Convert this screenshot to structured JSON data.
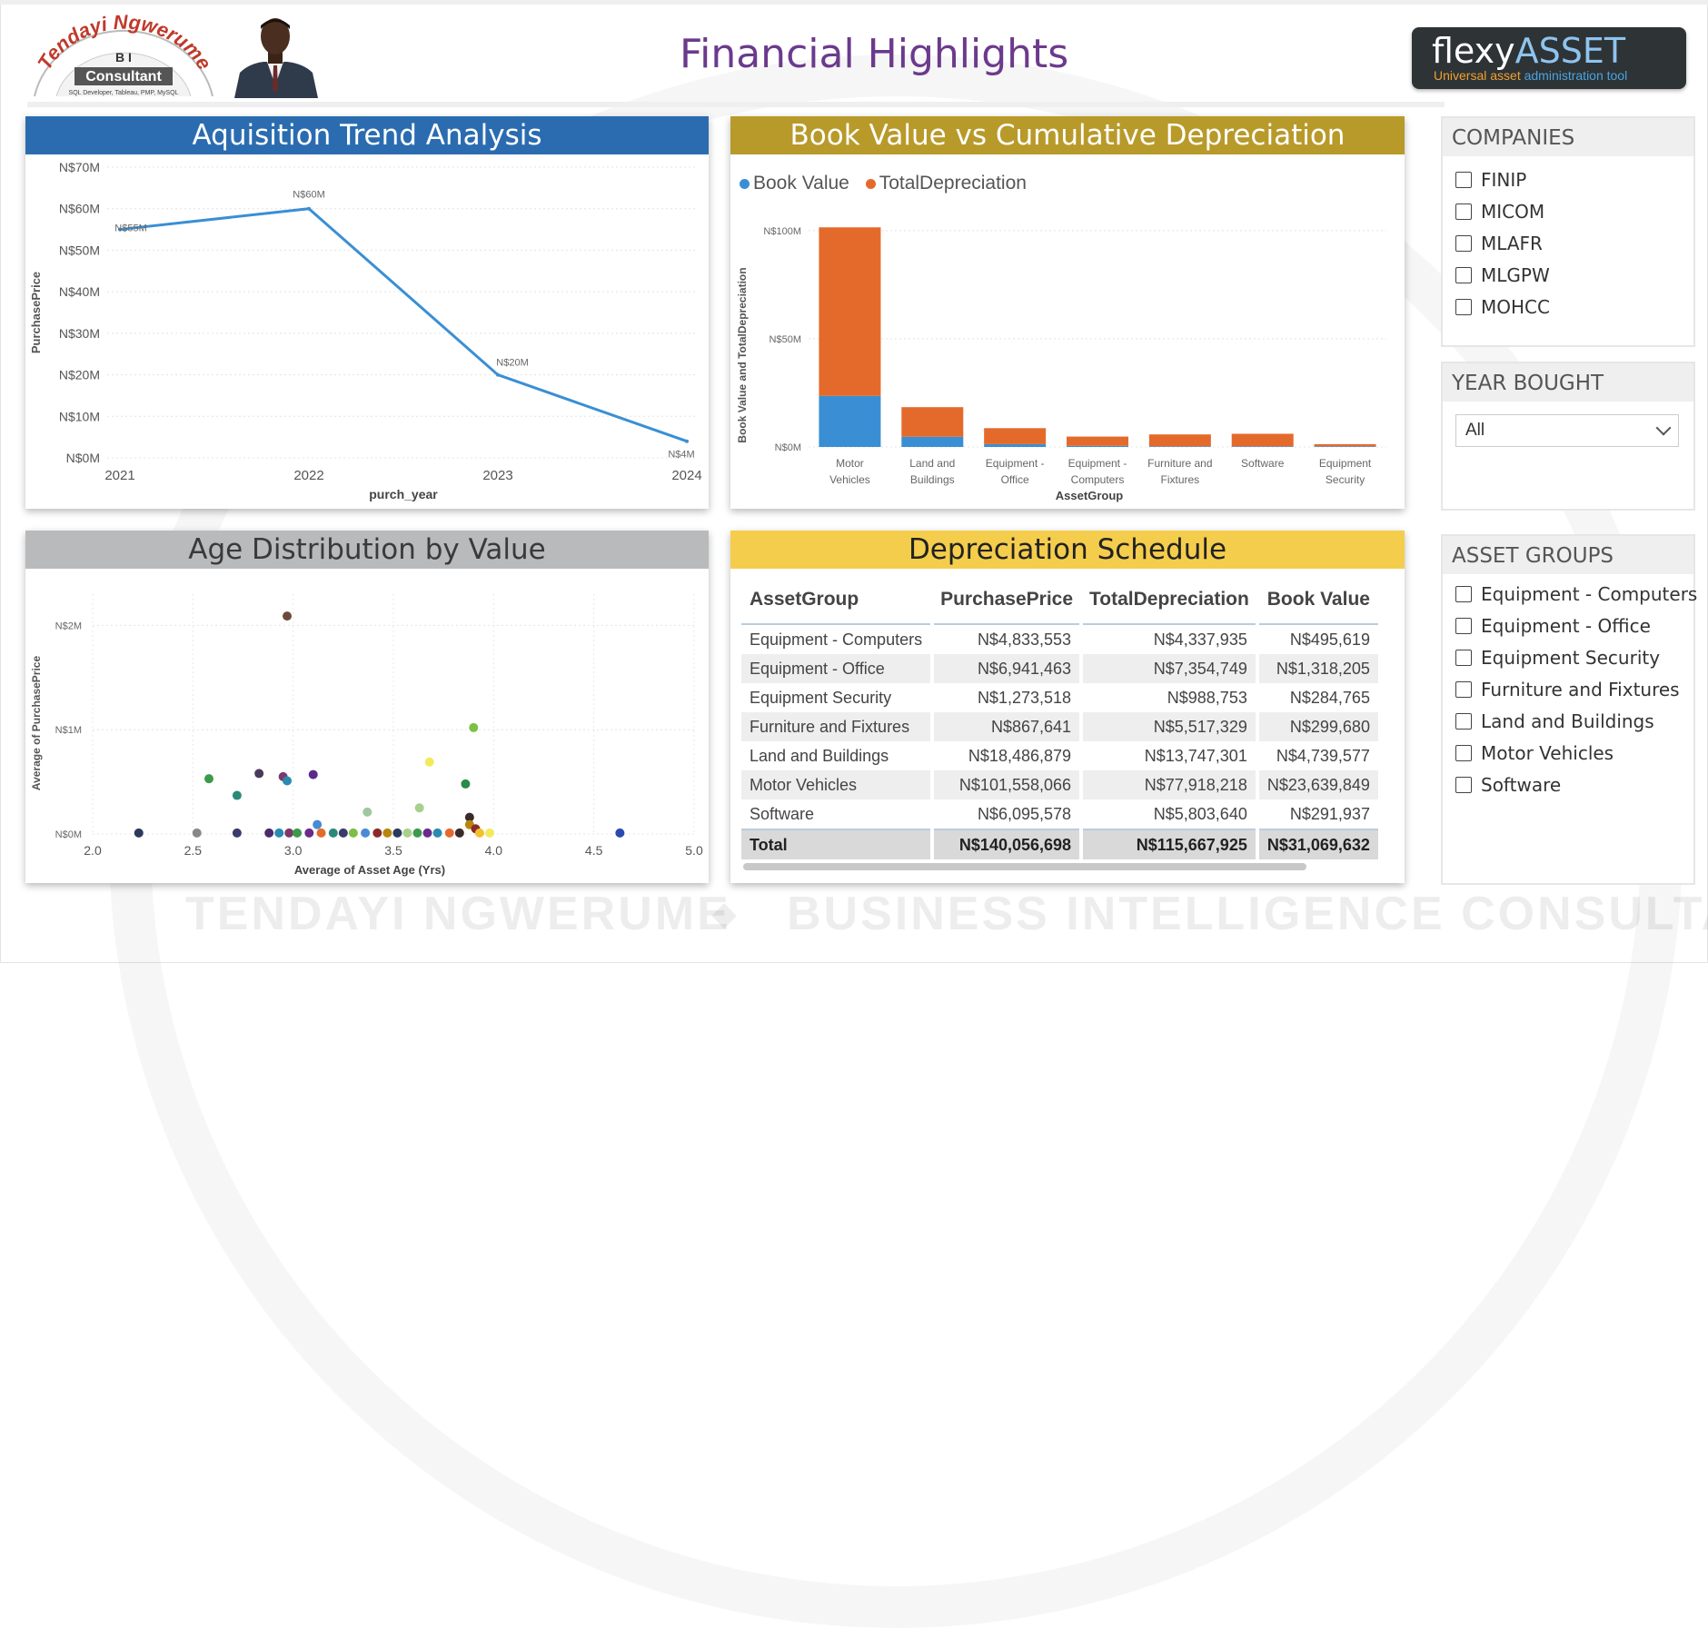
{
  "header": {
    "title": "Financial Highlights",
    "logo": {
      "script": "Tendayi Ngwerume",
      "bi": "B I",
      "consultant": "Consultant",
      "tagline": "SQL Developer, Tableau, PMP, MySQL"
    },
    "brand": {
      "name_a": "flexy",
      "name_b": "ASSET",
      "tag_a": "Universal asset ",
      "tag_b": "administration tool"
    }
  },
  "watermark": {
    "left": "TENDAYI NGWERUME",
    "separator": "◆",
    "right": "BUSINESS INTELLIGENCE CONSULTANT"
  },
  "colors": {
    "blue_header": "#2b6cb0",
    "gold_header": "#b89a2a",
    "grey_header": "#b9babc",
    "yellow_header": "#f5cd4c",
    "book_value": "#3a8fd4",
    "total_depreciation": "#e46a2b",
    "line": "#3a8fd4"
  },
  "panels": {
    "acquisition": {
      "title": "Aquisition Trend Analysis"
    },
    "book_value": {
      "title": "Book Value vs Cumulative Depreciation"
    },
    "age": {
      "title": "Age Distribution by Value"
    },
    "schedule": {
      "title": "Depreciation Schedule"
    }
  },
  "chart_data": [
    {
      "type": "line",
      "title": "Aquisition Trend Analysis",
      "xlabel": "purch_year",
      "ylabel": "PurchasePrice",
      "x": [
        2021,
        2022,
        2023,
        2024
      ],
      "values": [
        55,
        60,
        20,
        4
      ],
      "unit": "N$M",
      "data_labels": [
        "N$55M",
        "N$60M",
        "N$20M",
        "N$4M"
      ],
      "ylim": [
        0,
        70
      ],
      "y_ticks": [
        "N$0M",
        "N$10M",
        "N$20M",
        "N$30M",
        "N$40M",
        "N$50M",
        "N$60M",
        "N$70M"
      ],
      "x_ticks": [
        "2021",
        "2022",
        "2023",
        "2024"
      ],
      "grid": true
    },
    {
      "type": "bar",
      "stacked": true,
      "title": "Book Value vs Cumulative Depreciation",
      "xlabel": "AssetGroup",
      "ylabel": "Book Value and TotalDepreciation",
      "categories": [
        "Motor Vehicles",
        "Land and Buildings",
        "Equipment - Office",
        "Equipment - Computers",
        "Furniture and Fixtures",
        "Software",
        "Equipment Security"
      ],
      "category_lines": [
        [
          "Motor",
          "Vehicles"
        ],
        [
          "Land and",
          "Buildings"
        ],
        [
          "Equipment -",
          "Office"
        ],
        [
          "Equipment -",
          "Computers"
        ],
        [
          "Furniture and",
          "Fixtures"
        ],
        [
          "Software"
        ],
        [
          "Equipment",
          "Security"
        ]
      ],
      "series": [
        {
          "name": "Book Value",
          "values": [
            23.6,
            4.7,
            1.3,
            0.5,
            0.3,
            0.3,
            0.3
          ]
        },
        {
          "name": "TotalDepreciation",
          "values": [
            77.9,
            13.7,
            7.4,
            4.3,
            5.5,
            5.8,
            1.0
          ]
        }
      ],
      "unit": "N$M",
      "ylim": [
        0,
        110
      ],
      "y_ticks": [
        "N$0M",
        "N$50M",
        "N$100M"
      ],
      "legend_position": "top-left",
      "grid": true
    },
    {
      "type": "scatter",
      "title": "Age Distribution by Value",
      "xlabel": "Average of Asset Age (Yrs)",
      "ylabel": "Average of PurchasePrice",
      "xlim": [
        2.0,
        5.0
      ],
      "ylim": [
        0,
        2.3
      ],
      "x_ticks": [
        "2.0",
        "2.5",
        "3.0",
        "3.5",
        "4.0",
        "4.5",
        "5.0"
      ],
      "y_ticks": [
        "N$0M",
        "N$1M",
        "N$2M"
      ],
      "grid": true,
      "points": [
        {
          "x": 2.97,
          "y": 2.09,
          "color": "#6b4c3b"
        },
        {
          "x": 3.9,
          "y": 1.02,
          "color": "#7bc043"
        },
        {
          "x": 3.68,
          "y": 0.69,
          "color": "#f2ea5c"
        },
        {
          "x": 2.58,
          "y": 0.53,
          "color": "#3d9a4a"
        },
        {
          "x": 2.83,
          "y": 0.58,
          "color": "#4a3a5c"
        },
        {
          "x": 2.95,
          "y": 0.55,
          "color": "#7a3a6c"
        },
        {
          "x": 2.97,
          "y": 0.51,
          "color": "#2a8ab0"
        },
        {
          "x": 3.1,
          "y": 0.57,
          "color": "#5a2a8c"
        },
        {
          "x": 2.72,
          "y": 0.37,
          "color": "#2a8a7a"
        },
        {
          "x": 3.86,
          "y": 0.48,
          "color": "#2a8a4a"
        },
        {
          "x": 3.63,
          "y": 0.25,
          "color": "#a8d08d"
        },
        {
          "x": 3.37,
          "y": 0.21,
          "color": "#9fc7a0"
        },
        {
          "x": 3.88,
          "y": 0.16,
          "color": "#3a2a2a"
        },
        {
          "x": 3.12,
          "y": 0.09,
          "color": "#4a8ad4"
        },
        {
          "x": 3.88,
          "y": 0.09,
          "color": "#b8860b"
        },
        {
          "x": 3.91,
          "y": 0.05,
          "color": "#8b2a2a"
        },
        {
          "x": 2.23,
          "y": 0.01,
          "color": "#2a3a5c"
        },
        {
          "x": 2.52,
          "y": 0.01,
          "color": "#888888"
        },
        {
          "x": 2.72,
          "y": 0.01,
          "color": "#3a3a6c"
        },
        {
          "x": 2.88,
          "y": 0.01,
          "color": "#4a2a6c"
        },
        {
          "x": 2.93,
          "y": 0.01,
          "color": "#2a8ab0"
        },
        {
          "x": 2.98,
          "y": 0.01,
          "color": "#7a3a6c"
        },
        {
          "x": 3.02,
          "y": 0.01,
          "color": "#3d9a4a"
        },
        {
          "x": 3.08,
          "y": 0.01,
          "color": "#6a2a8c"
        },
        {
          "x": 3.14,
          "y": 0.01,
          "color": "#e46a2b"
        },
        {
          "x": 3.2,
          "y": 0.01,
          "color": "#2a8a7a"
        },
        {
          "x": 3.25,
          "y": 0.01,
          "color": "#3a3a6c"
        },
        {
          "x": 3.3,
          "y": 0.01,
          "color": "#7bc043"
        },
        {
          "x": 3.36,
          "y": 0.01,
          "color": "#4a8ad4"
        },
        {
          "x": 3.42,
          "y": 0.01,
          "color": "#8b2a2a"
        },
        {
          "x": 3.47,
          "y": 0.01,
          "color": "#b8860b"
        },
        {
          "x": 3.52,
          "y": 0.01,
          "color": "#2a3a5c"
        },
        {
          "x": 3.57,
          "y": 0.01,
          "color": "#a8d08d"
        },
        {
          "x": 3.62,
          "y": 0.01,
          "color": "#3d9a4a"
        },
        {
          "x": 3.67,
          "y": 0.01,
          "color": "#6a2a8c"
        },
        {
          "x": 3.72,
          "y": 0.01,
          "color": "#2a8ab0"
        },
        {
          "x": 3.78,
          "y": 0.01,
          "color": "#e46a2b"
        },
        {
          "x": 3.83,
          "y": 0.01,
          "color": "#3a2a2a"
        },
        {
          "x": 3.93,
          "y": 0.01,
          "color": "#f2c02a"
        },
        {
          "x": 3.98,
          "y": 0.01,
          "color": "#f2ea5c"
        },
        {
          "x": 4.63,
          "y": 0.01,
          "color": "#2a4ab0"
        }
      ]
    },
    {
      "type": "table",
      "title": "Depreciation Schedule",
      "columns": [
        "AssetGroup",
        "PurchasePrice",
        "TotalDepreciation",
        "Book Value"
      ],
      "rows": [
        [
          "Equipment - Computers",
          "N$4,833,553",
          "N$4,337,935",
          "N$495,619"
        ],
        [
          "Equipment - Office",
          "N$6,941,463",
          "N$7,354,749",
          "N$1,318,205"
        ],
        [
          "Equipment Security",
          "N$1,273,518",
          "N$988,753",
          "N$284,765"
        ],
        [
          "Furniture and Fixtures",
          "N$867,641",
          "N$5,517,329",
          "N$299,680"
        ],
        [
          "Land and Buildings",
          "N$18,486,879",
          "N$13,747,301",
          "N$4,739,577"
        ],
        [
          "Motor Vehicles",
          "N$101,558,066",
          "N$77,918,218",
          "N$23,639,849"
        ],
        [
          "Software",
          "N$6,095,578",
          "N$5,803,640",
          "N$291,937"
        ]
      ],
      "total": [
        "Total",
        "N$140,056,698",
        "N$115,667,925",
        "N$31,069,632"
      ]
    }
  ],
  "slicers": {
    "companies": {
      "title": "COMPANIES",
      "items": [
        "FINIP",
        "MICOM",
        "MLAFR",
        "MLGPW",
        "MOHCC"
      ]
    },
    "year": {
      "title": "YEAR BOUGHT",
      "value": "All"
    },
    "asset_groups": {
      "title": "ASSET GROUPS",
      "items": [
        "Equipment - Computers",
        "Equipment - Office",
        "Equipment Security",
        "Furniture and Fixtures",
        "Land and Buildings",
        "Motor Vehicles",
        "Software"
      ]
    }
  }
}
